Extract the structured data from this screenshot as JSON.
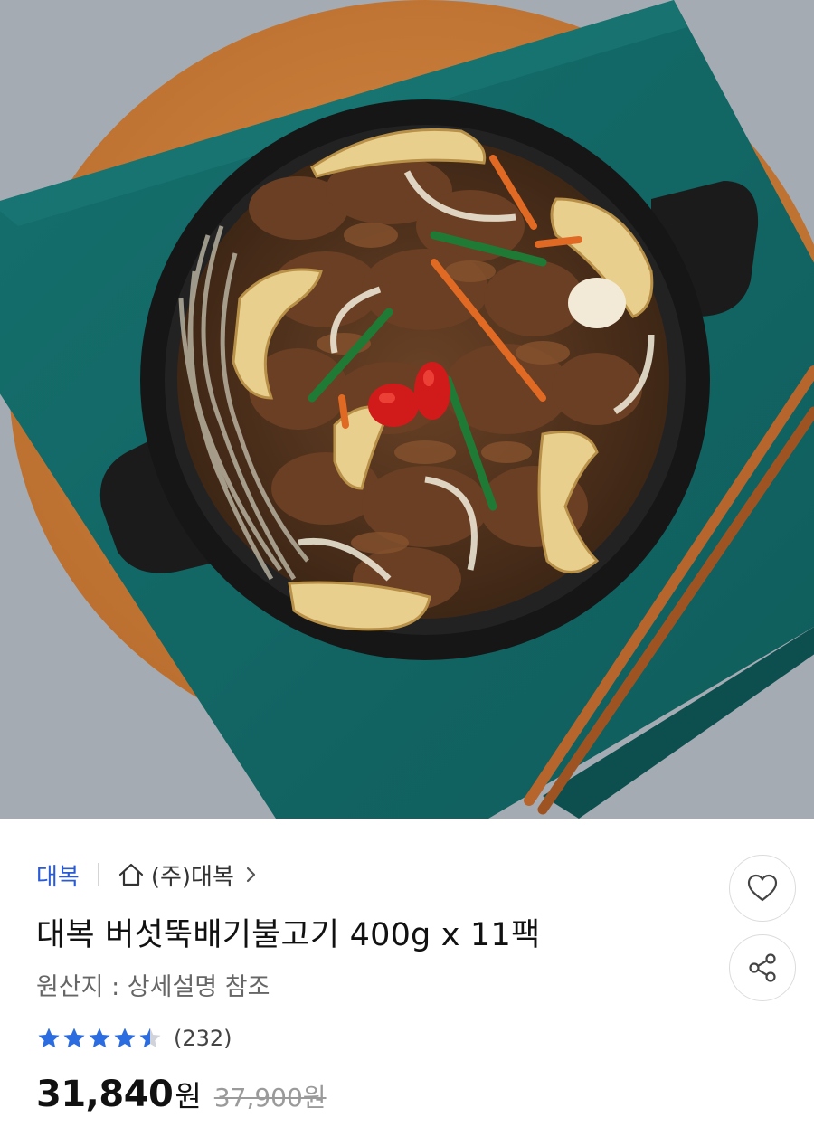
{
  "product": {
    "image_alt": "대복 버섯뚝배기불고기",
    "brand": "대복",
    "store": "(주)대복",
    "title": "대복 버섯뚝배기불고기 400g x 11팩",
    "origin": "원산지 : 상세설명 참조",
    "rating": 4.5,
    "review_count": "(232)",
    "price": {
      "sale": "31,840",
      "sale_unit": "원",
      "original": "37,900원"
    }
  },
  "icons": {
    "home": "home-icon",
    "chevron": "chevron-right-icon",
    "wishlist": "heart-icon",
    "share": "share-icon",
    "star": "star-icon"
  },
  "colors": {
    "brand_link": "#2a5bd7",
    "star": "#2b6de0",
    "star_empty": "#d0d4da",
    "original_price": "#9a9a9a"
  }
}
